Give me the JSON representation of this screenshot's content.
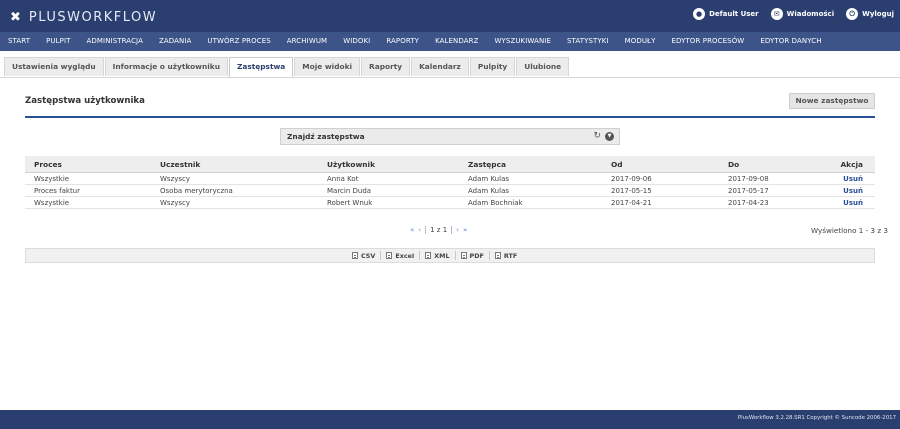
{
  "header": {
    "logo_text": "PLUSWORKFLOW",
    "user": {
      "icon": "user-icon",
      "label": "Default User"
    },
    "messages": {
      "icon": "mail-icon",
      "label": "Wiadomości"
    },
    "logout": {
      "icon": "power-icon",
      "label": "Wyloguj"
    }
  },
  "nav": {
    "items": [
      "START",
      "PULPIT",
      "ADMINISTRACJA",
      "ZADANIA",
      "UTWÓRZ PROCES",
      "ARCHIWUM",
      "WIDOKI",
      "RAPORTY",
      "KALENDARZ",
      "WYSZUKIWANIE",
      "STATYSTYKI",
      "MODUŁY",
      "EDYTOR PROCESÓW",
      "EDYTOR DANYCH"
    ]
  },
  "tabs": {
    "items": [
      "Ustawienia wyglądu",
      "Informacje o użytkowniku",
      "Zastępstwa",
      "Moje widoki",
      "Raporty",
      "Kalendarz",
      "Pulpity",
      "Ulubione"
    ],
    "active": "Zastępstwa"
  },
  "section": {
    "title": "Zastępstwa użytkownika",
    "new_button": "Nowe zastępstwo"
  },
  "finder": {
    "label": "Znajdź zastępstwa"
  },
  "table": {
    "headers": [
      "Proces",
      "Uczestnik",
      "Użytkownik",
      "Zastępca",
      "Od",
      "Do",
      "Akcja"
    ],
    "rows": [
      [
        "Wszystkie",
        "Wszyscy",
        "Anna Kot",
        "Adam Kulas",
        "2017-09-06",
        "2017-09-08",
        "Usuń"
      ],
      [
        "Proces faktur",
        "Osoba merytoryczna",
        "Marcin Duda",
        "Adam Kulas",
        "2017-05-15",
        "2017-05-17",
        "Usuń"
      ],
      [
        "Wszystkie",
        "Wszyscy",
        "Robert Wnuk",
        "Adam Bochniak",
        "2017-04-21",
        "2017-04-23",
        "Usuń"
      ]
    ]
  },
  "pager": {
    "first": "«",
    "prev": "‹",
    "info": "1 z 1",
    "next": "›",
    "last": "»",
    "count_text": "Wyświetlono 1 - 3 z 3"
  },
  "export": {
    "items": [
      "CSV",
      "Excel",
      "XML",
      "PDF",
      "RTF"
    ]
  },
  "footer": {
    "text": "PlusWorkflow 3.2.28.SR1 Copyright © Suncode 2006-2017"
  },
  "colors": {
    "header_bg": "#2a3f6f",
    "nav_bg": "#3c5488",
    "accent": "#2a4f95"
  }
}
